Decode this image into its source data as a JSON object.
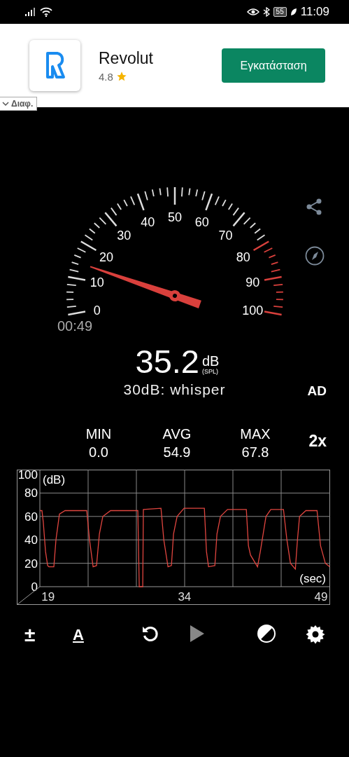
{
  "status_bar": {
    "battery": "55",
    "time": "11:09"
  },
  "ad": {
    "app_name": "Revolut",
    "rating": "4.8",
    "install_button": "Εγκατάσταση",
    "more_tab": "Διαφ."
  },
  "gauge": {
    "scale_labels": [
      "0",
      "10",
      "20",
      "30",
      "40",
      "50",
      "60",
      "70",
      "80",
      "90",
      "100"
    ],
    "elapsed": "00:49"
  },
  "reading": {
    "value": "35.2",
    "unit": "dB",
    "weighting": "(SPL)",
    "reference": "30dB: whisper",
    "ad_label": "AD"
  },
  "stats": [
    {
      "label": "MIN",
      "value": "0.0"
    },
    {
      "label": "AVG",
      "value": "54.9"
    },
    {
      "label": "MAX",
      "value": "67.8"
    }
  ],
  "zoom_button": "2x",
  "history": {
    "chart_data": {
      "type": "line",
      "grid": true,
      "xlabel": "(sec)",
      "ylabel": "(dB)",
      "xlim": [
        18.1,
        50
      ],
      "ylim": [
        0,
        100
      ],
      "xticks": [
        19,
        34,
        49
      ],
      "yticks": [
        0,
        20,
        40,
        60,
        80,
        100
      ],
      "x": [
        18.1,
        18.33,
        18.48,
        18.72,
        18.95,
        19.1,
        19.64,
        19.87,
        20.25,
        20.87,
        23.25,
        23.56,
        23.95,
        24.33,
        24.64,
        25.02,
        25.87,
        28.87,
        29.02,
        29.41,
        29.48,
        31.41,
        31.72,
        32.18,
        32.56,
        32.79,
        33.18,
        33.95,
        36.18,
        36.41,
        36.64,
        37.33,
        37.56,
        37.95,
        38.72,
        40.79,
        41.02,
        41.25,
        42.02,
        42.33,
        42.95,
        43.48,
        44.87,
        45.25,
        45.64,
        46.18,
        46.41,
        46.64,
        47.33,
        48.56,
        48.95,
        49.48,
        49.95
      ],
      "series": [
        {
          "color": "#e0453f",
          "values": [
            65,
            65,
            55,
            30,
            18,
            17,
            17,
            40,
            62,
            65,
            65,
            40,
            17,
            18,
            45,
            60,
            65,
            65,
            0,
            0,
            66,
            67,
            40,
            17,
            18,
            45,
            60,
            67,
            67,
            30,
            17,
            18,
            45,
            60,
            66,
            66,
            35,
            27,
            17,
            30,
            60,
            66,
            66,
            40,
            20,
            15,
            40,
            60,
            65,
            65,
            35,
            20,
            17
          ]
        }
      ]
    }
  },
  "toolbar": [
    {
      "kind": "glyph",
      "text": "±"
    },
    {
      "kind": "glyph",
      "text": "A"
    },
    {
      "kind": "reset"
    },
    {
      "kind": "play",
      "disabled": true
    },
    {
      "kind": "contrast"
    },
    {
      "kind": "settings"
    }
  ]
}
